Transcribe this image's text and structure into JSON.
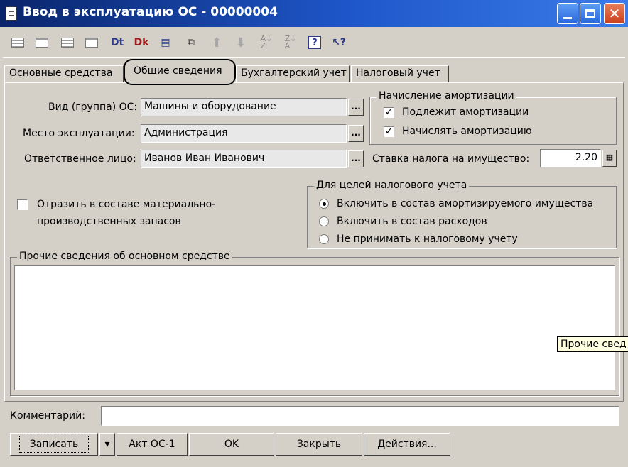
{
  "window": {
    "title": "Ввод в эксплуатацию ОС - 00000004",
    "minimize": "",
    "maximize": "",
    "close": "✕"
  },
  "toolbar": {
    "icons": [
      "sheet-icon",
      "sheet-header-icon",
      "sheet-list-icon",
      "sheet-tree-icon",
      "dt-journal-icon",
      "dk-journal-icon",
      "document-icon",
      "structure-icon",
      "arrow-up-icon",
      "arrow-down-icon",
      "sort-asc-icon",
      "sort-desc-icon",
      "help-icon",
      "pointer-help-icon"
    ]
  },
  "tabs": {
    "items": [
      "Основные средства",
      "Общие сведения",
      "Бухгалтерский учет",
      "Налоговый учет"
    ],
    "active": "Общие сведения"
  },
  "form": {
    "vid_label": "Вид (группа) ОС:",
    "vid_value": "Машины и оборудование",
    "place_label": "Место эксплуатации:",
    "place_value": "Администрация",
    "person_label": "Ответственное лицо:",
    "person_value": "Иванов Иван Иванович",
    "pick_button": "...",
    "reflect_label_1": "Отразить в составе материально-",
    "reflect_label_2": "производственных запасов",
    "reflect_checked": false
  },
  "amortization": {
    "legend": "Начисление амортизации",
    "subject_label": "Подлежит амортизации",
    "subject_checked": true,
    "accrue_label": "Начислять амортизацию",
    "accrue_checked": true,
    "tax_rate_label": "Ставка налога на имущество:",
    "tax_rate_value": "2.20"
  },
  "tax_accounting": {
    "legend": "Для целей налогового учета",
    "options": [
      "Включить в состав амортизируемого имущества",
      "Включить в состав расходов",
      "Не принимать к налоговому учету"
    ],
    "selected": "Включить в состав амортизируемого имущества"
  },
  "other_info": {
    "legend": "Прочие сведения об основном средстве",
    "value": "",
    "tooltip": "Прочие свед"
  },
  "comment": {
    "label": "Комментарий:",
    "value": ""
  },
  "buttons": {
    "save": "Записать",
    "dropdown": "▾",
    "act": "Акт ОС-1",
    "ok": "OK",
    "close": "Закрыть",
    "actions": "Действия..."
  },
  "colors": {
    "titlebar": "#0a246a",
    "face": "#d4d0c8",
    "field": "#e8e8e8"
  }
}
